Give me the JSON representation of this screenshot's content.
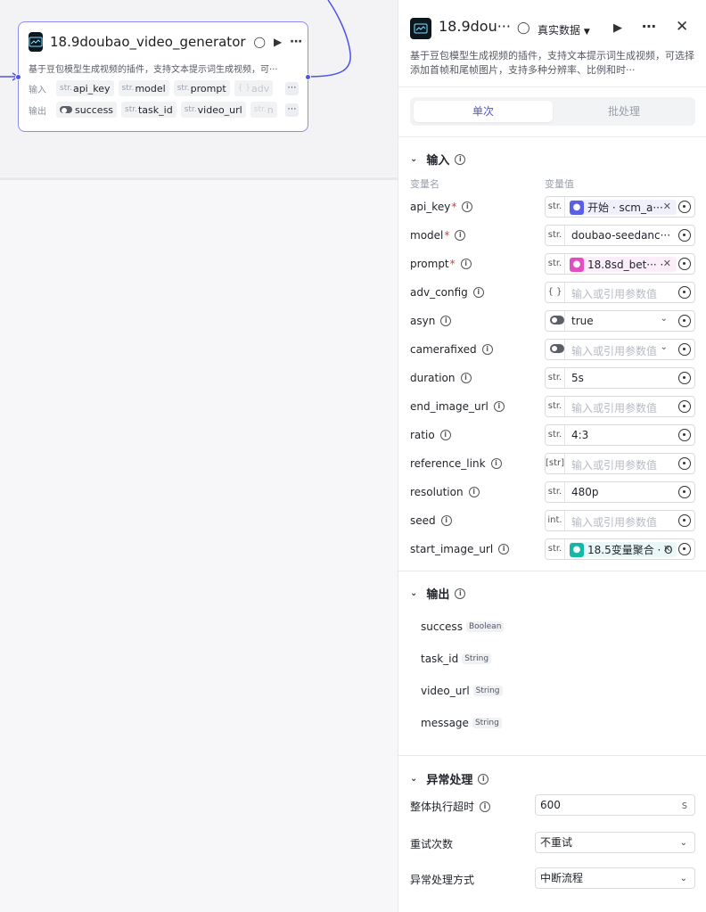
{
  "node": {
    "title": "18.9doubao_video_generator",
    "description": "基于豆包模型生成视频的插件，支持文本提示词生成视频，可···",
    "input_label": "输入",
    "output_label": "输出",
    "inputs": [
      {
        "type": "str.",
        "name": "api_key"
      },
      {
        "type": "str.",
        "name": "model"
      },
      {
        "type": "str.",
        "name": "prompt"
      },
      {
        "type": "{ }",
        "name": "adv"
      }
    ],
    "outputs": [
      {
        "type": "toggle",
        "name": "success"
      },
      {
        "type": "str.",
        "name": "task_id"
      },
      {
        "type": "str.",
        "name": "video_url"
      },
      {
        "type": "str.",
        "name": "n"
      }
    ]
  },
  "panel": {
    "title": "18.9dou···",
    "data_mode": "真实数据",
    "description": "基于豆包模型生成视频的插件，支持文本提示词生成视频，可选择添加首帧和尾帧图片，支持多种分辨率、比例和时···",
    "tabs": [
      "单次",
      "批处理"
    ],
    "input_section": "输入",
    "col_name": "变量名",
    "col_value": "变量值",
    "params": [
      {
        "name": "api_key",
        "required": "*",
        "type": "str.",
        "ref": "开始 · scm_a···",
        "ref_color": "#5b5fe8"
      },
      {
        "name": "model",
        "required": "*",
        "type": "str.",
        "value": "doubao-seedanc···"
      },
      {
        "name": "prompt",
        "required": "*",
        "type": "str.",
        "ref": "18.8sd_bet··· ·",
        "ref_color": "#e04ec2"
      },
      {
        "name": "adv_config",
        "required": "",
        "type": "{ }",
        "placeholder": "输入或引用参数值"
      },
      {
        "name": "asyn",
        "required": "",
        "type": "toggle",
        "value": "true",
        "dropdown": true
      },
      {
        "name": "camerafixed",
        "required": "",
        "type": "toggle",
        "placeholder": "输入或引用参数值",
        "dropdown": true
      },
      {
        "name": "duration",
        "required": "",
        "type": "str.",
        "value": "5s"
      },
      {
        "name": "end_image_url",
        "required": "",
        "type": "str.",
        "placeholder": "输入或引用参数值"
      },
      {
        "name": "ratio",
        "required": "",
        "type": "str.",
        "value": "4:3"
      },
      {
        "name": "reference_link",
        "required": "",
        "type": "[str]",
        "placeholder": "输入或引用参数值"
      },
      {
        "name": "resolution",
        "required": "",
        "type": "str.",
        "value": "480p"
      },
      {
        "name": "seed",
        "required": "",
        "type": "int.",
        "placeholder": "输入或引用参数值"
      },
      {
        "name": "start_image_url",
        "required": "",
        "type": "str.",
        "ref": "18.5变量聚合 · O",
        "ref_color": "#14b8a6"
      }
    ],
    "output_section": "输出",
    "outputs": [
      {
        "name": "success",
        "type": "Boolean"
      },
      {
        "name": "task_id",
        "type": "String"
      },
      {
        "name": "video_url",
        "type": "String"
      },
      {
        "name": "message",
        "type": "String"
      }
    ],
    "error_section": "异常处理",
    "timeout_label": "整体执行超时",
    "timeout_value": "600",
    "timeout_unit": "s",
    "retry_label": "重试次数",
    "retry_value": "不重试",
    "handler_label": "异常处理方式",
    "handler_value": "中断流程"
  },
  "colors": {
    "accent": "#4d53e8",
    "node_border": "#8c8cf0"
  }
}
